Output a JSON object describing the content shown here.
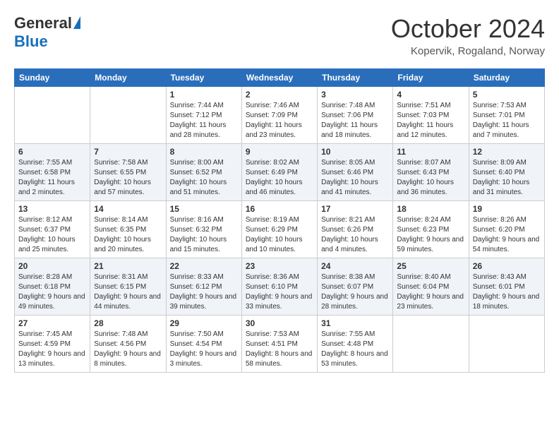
{
  "header": {
    "logo_general": "General",
    "logo_blue": "Blue",
    "month_title": "October 2024",
    "location": "Kopervik, Rogaland, Norway"
  },
  "weekdays": [
    "Sunday",
    "Monday",
    "Tuesday",
    "Wednesday",
    "Thursday",
    "Friday",
    "Saturday"
  ],
  "weeks": [
    [
      {
        "day": "",
        "info": ""
      },
      {
        "day": "",
        "info": ""
      },
      {
        "day": "1",
        "info": "Sunrise: 7:44 AM\nSunset: 7:12 PM\nDaylight: 11 hours and 28 minutes."
      },
      {
        "day": "2",
        "info": "Sunrise: 7:46 AM\nSunset: 7:09 PM\nDaylight: 11 hours and 23 minutes."
      },
      {
        "day": "3",
        "info": "Sunrise: 7:48 AM\nSunset: 7:06 PM\nDaylight: 11 hours and 18 minutes."
      },
      {
        "day": "4",
        "info": "Sunrise: 7:51 AM\nSunset: 7:03 PM\nDaylight: 11 hours and 12 minutes."
      },
      {
        "day": "5",
        "info": "Sunrise: 7:53 AM\nSunset: 7:01 PM\nDaylight: 11 hours and 7 minutes."
      }
    ],
    [
      {
        "day": "6",
        "info": "Sunrise: 7:55 AM\nSunset: 6:58 PM\nDaylight: 11 hours and 2 minutes."
      },
      {
        "day": "7",
        "info": "Sunrise: 7:58 AM\nSunset: 6:55 PM\nDaylight: 10 hours and 57 minutes."
      },
      {
        "day": "8",
        "info": "Sunrise: 8:00 AM\nSunset: 6:52 PM\nDaylight: 10 hours and 51 minutes."
      },
      {
        "day": "9",
        "info": "Sunrise: 8:02 AM\nSunset: 6:49 PM\nDaylight: 10 hours and 46 minutes."
      },
      {
        "day": "10",
        "info": "Sunrise: 8:05 AM\nSunset: 6:46 PM\nDaylight: 10 hours and 41 minutes."
      },
      {
        "day": "11",
        "info": "Sunrise: 8:07 AM\nSunset: 6:43 PM\nDaylight: 10 hours and 36 minutes."
      },
      {
        "day": "12",
        "info": "Sunrise: 8:09 AM\nSunset: 6:40 PM\nDaylight: 10 hours and 31 minutes."
      }
    ],
    [
      {
        "day": "13",
        "info": "Sunrise: 8:12 AM\nSunset: 6:37 PM\nDaylight: 10 hours and 25 minutes."
      },
      {
        "day": "14",
        "info": "Sunrise: 8:14 AM\nSunset: 6:35 PM\nDaylight: 10 hours and 20 minutes."
      },
      {
        "day": "15",
        "info": "Sunrise: 8:16 AM\nSunset: 6:32 PM\nDaylight: 10 hours and 15 minutes."
      },
      {
        "day": "16",
        "info": "Sunrise: 8:19 AM\nSunset: 6:29 PM\nDaylight: 10 hours and 10 minutes."
      },
      {
        "day": "17",
        "info": "Sunrise: 8:21 AM\nSunset: 6:26 PM\nDaylight: 10 hours and 4 minutes."
      },
      {
        "day": "18",
        "info": "Sunrise: 8:24 AM\nSunset: 6:23 PM\nDaylight: 9 hours and 59 minutes."
      },
      {
        "day": "19",
        "info": "Sunrise: 8:26 AM\nSunset: 6:20 PM\nDaylight: 9 hours and 54 minutes."
      }
    ],
    [
      {
        "day": "20",
        "info": "Sunrise: 8:28 AM\nSunset: 6:18 PM\nDaylight: 9 hours and 49 minutes."
      },
      {
        "day": "21",
        "info": "Sunrise: 8:31 AM\nSunset: 6:15 PM\nDaylight: 9 hours and 44 minutes."
      },
      {
        "day": "22",
        "info": "Sunrise: 8:33 AM\nSunset: 6:12 PM\nDaylight: 9 hours and 39 minutes."
      },
      {
        "day": "23",
        "info": "Sunrise: 8:36 AM\nSunset: 6:10 PM\nDaylight: 9 hours and 33 minutes."
      },
      {
        "day": "24",
        "info": "Sunrise: 8:38 AM\nSunset: 6:07 PM\nDaylight: 9 hours and 28 minutes."
      },
      {
        "day": "25",
        "info": "Sunrise: 8:40 AM\nSunset: 6:04 PM\nDaylight: 9 hours and 23 minutes."
      },
      {
        "day": "26",
        "info": "Sunrise: 8:43 AM\nSunset: 6:01 PM\nDaylight: 9 hours and 18 minutes."
      }
    ],
    [
      {
        "day": "27",
        "info": "Sunrise: 7:45 AM\nSunset: 4:59 PM\nDaylight: 9 hours and 13 minutes."
      },
      {
        "day": "28",
        "info": "Sunrise: 7:48 AM\nSunset: 4:56 PM\nDaylight: 9 hours and 8 minutes."
      },
      {
        "day": "29",
        "info": "Sunrise: 7:50 AM\nSunset: 4:54 PM\nDaylight: 9 hours and 3 minutes."
      },
      {
        "day": "30",
        "info": "Sunrise: 7:53 AM\nSunset: 4:51 PM\nDaylight: 8 hours and 58 minutes."
      },
      {
        "day": "31",
        "info": "Sunrise: 7:55 AM\nSunset: 4:48 PM\nDaylight: 8 hours and 53 minutes."
      },
      {
        "day": "",
        "info": ""
      },
      {
        "day": "",
        "info": ""
      }
    ]
  ]
}
